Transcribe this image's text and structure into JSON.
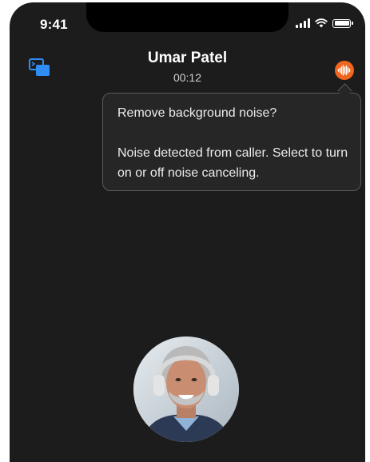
{
  "status_bar": {
    "time": "9:41",
    "icons": [
      "cellular-signal-icon",
      "wifi-icon",
      "battery-icon"
    ]
  },
  "header": {
    "caller_name": "Umar Patel",
    "call_duration": "00:12",
    "share_icon": "screen-share-icon",
    "noise_icon": "noise-cancel-icon"
  },
  "tooltip": {
    "title": "Remove background noise?",
    "body": "Noise detected from caller. Select to turn on or off noise canceling."
  },
  "colors": {
    "background": "#1c1c1c",
    "accent_blue": "#2f8ef5",
    "accent_orange": "#f0661e"
  }
}
